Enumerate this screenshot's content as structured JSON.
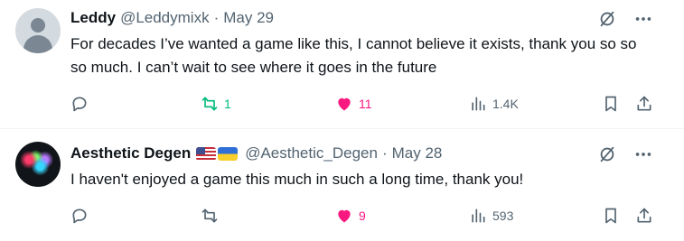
{
  "tweets": [
    {
      "author_name": "Leddy",
      "handle": "@Leddymixk",
      "separator": "·",
      "date": "May 29",
      "avatar_icon": "default-avatar-icon",
      "text": "For decades I’ve wanted a game like this, I cannot believe it exists, thank you so so so much. I can’t wait to see where it goes in the future",
      "reposts": "1",
      "likes": "11",
      "views": "1.4K"
    },
    {
      "author_name": "Aesthetic Degen",
      "flags": [
        "us-flag-icon",
        "ukraine-flag-icon"
      ],
      "handle": "@Aesthetic_Degen",
      "separator": "·",
      "date": "May 28",
      "avatar_icon": "profile-photo",
      "text": "I haven't enjoyed a game this much in such a long time, thank you!",
      "reposts": "",
      "likes": "9",
      "views": "593"
    }
  ],
  "colors": {
    "text": "#0f1419",
    "muted": "#536471",
    "repost_active": "#00ba7c",
    "like_active": "#f91880",
    "divider": "#eff3f4"
  },
  "icons": [
    "grok-icon",
    "more-icon",
    "reply-icon",
    "repost-icon",
    "like-icon",
    "views-icon",
    "bookmark-icon",
    "share-icon"
  ]
}
